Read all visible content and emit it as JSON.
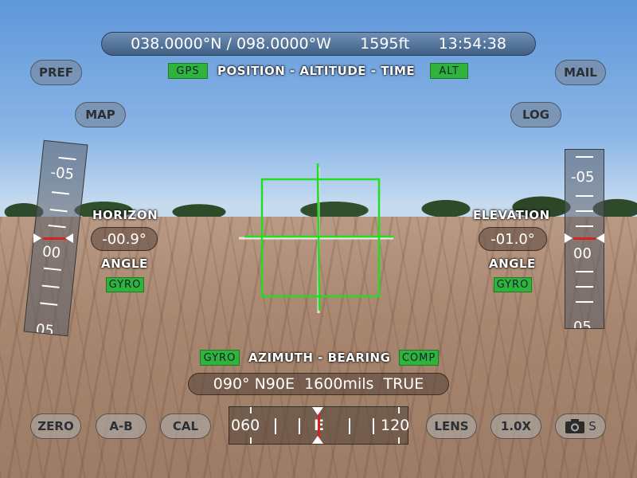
{
  "top_readout": {
    "latitude": "038.0000°N",
    "separator": "/",
    "longitude": "098.0000°W",
    "altitude": "1595ft",
    "time": "13:54:38"
  },
  "top_caption": {
    "left_tag": "GPS",
    "title": "POSITION - ALTITUDE - TIME",
    "right_tag": "ALT"
  },
  "buttons": {
    "pref": "PREF",
    "map": "MAP",
    "mail": "MAIL",
    "log": "LOG",
    "zero": "ZERO",
    "ab": "A-B",
    "cal": "CAL",
    "lens": "LENS",
    "zoom": "1.0X",
    "camera_suffix": "S"
  },
  "horizon": {
    "title": "HORIZON",
    "value": "-00.9°",
    "subtitle": "ANGLE",
    "source": "GYRO",
    "scale_labels": [
      "-05",
      "00",
      "05"
    ]
  },
  "elevation": {
    "title": "ELEVATION",
    "value": "-01.0°",
    "subtitle": "ANGLE",
    "source": "GYRO",
    "scale_labels": [
      "-05",
      "00",
      "05"
    ]
  },
  "azimuth": {
    "left_tag": "GYRO",
    "title": "AZIMUTH - BEARING",
    "right_tag": "COMP",
    "degrees": "090°",
    "quadrant": "N90E",
    "mils": "1600mils",
    "reference": "TRUE"
  },
  "compass_tape": {
    "left_label": "060",
    "center_label": "E",
    "right_label": "120"
  },
  "colors": {
    "status_green": "#2fb33a",
    "reticle_green": "#22dd22",
    "indicator_red": "#d82020"
  }
}
